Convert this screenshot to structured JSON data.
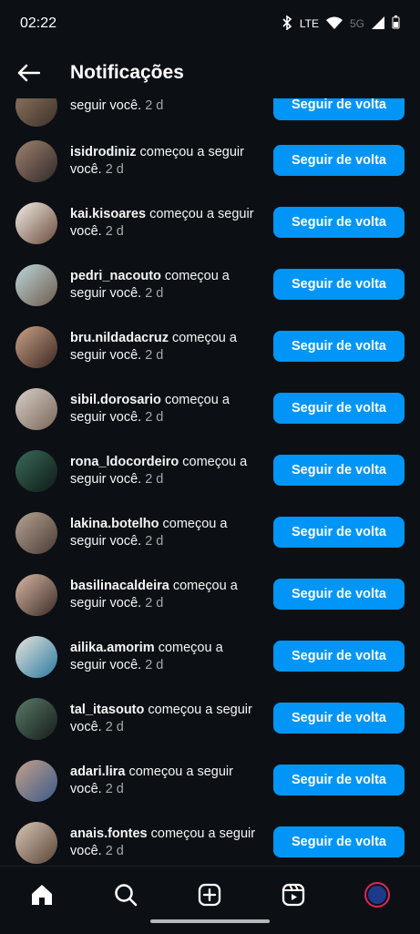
{
  "status": {
    "time": "02:22",
    "lte_label": "LTE",
    "net_label": "5G"
  },
  "header": {
    "title": "Notificações"
  },
  "notifications": [
    {
      "username": "",
      "text": "seguir você.",
      "time": "2 d",
      "button": "Seguir de volta"
    },
    {
      "username": "isidrodiniz",
      "text": " começou a seguir você.",
      "time": "2 d",
      "button": "Seguir de volta"
    },
    {
      "username": "kai.kisoares",
      "text": " começou a seguir você.",
      "time": "2 d",
      "button": "Seguir de volta"
    },
    {
      "username": "pedri_nacouto",
      "text": " começou a seguir você.",
      "time": "2 d",
      "button": "Seguir de volta"
    },
    {
      "username": "bru.nildadacruz",
      "text": " começou a seguir você.",
      "time": "2 d",
      "button": "Seguir de volta"
    },
    {
      "username": "sibil.dorosario",
      "text": " começou a seguir você.",
      "time": "2 d",
      "button": "Seguir de volta"
    },
    {
      "username": "rona_ldocordeiro",
      "text": " começou a seguir você.",
      "time": "2 d",
      "button": "Seguir de volta"
    },
    {
      "username": "lakina.botelho",
      "text": " começou a seguir você.",
      "time": "2 d",
      "button": "Seguir de volta"
    },
    {
      "username": "basilinacaldeira",
      "text": " começou a seguir você.",
      "time": "2 d",
      "button": "Seguir de volta"
    },
    {
      "username": "ailika.amorim",
      "text": " começou a seguir você.",
      "time": "2 d",
      "button": "Seguir de volta"
    },
    {
      "username": "tal_itasouto",
      "text": " começou a seguir você.",
      "time": "2 d",
      "button": "Seguir de volta"
    },
    {
      "username": "adari.lira",
      "text": " começou a seguir você.",
      "time": "2 d",
      "button": "Seguir de volta"
    },
    {
      "username": "anais.fontes",
      "text": " começou a seguir você.",
      "time": "2 d",
      "button": "Seguir de volta"
    }
  ],
  "nav": {
    "items": [
      "home-icon",
      "search-icon",
      "create-icon",
      "reels-icon",
      "profile-icon"
    ]
  },
  "colors": {
    "background": "#0c1014",
    "button": "#0095f6",
    "muted_text": "#a8a8a8"
  }
}
